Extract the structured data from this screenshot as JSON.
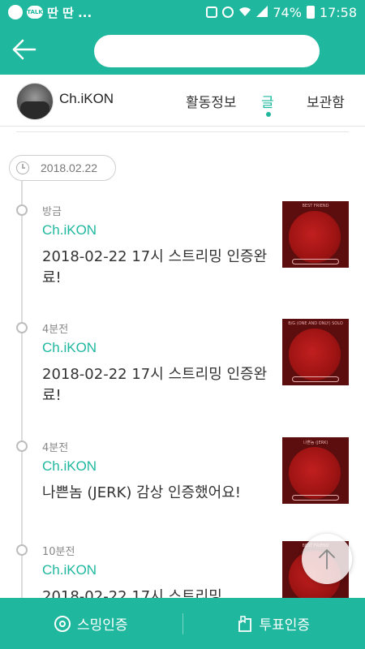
{
  "status_bar": {
    "app_icons_text": "딴 딴 ...",
    "talk_label": "TALK",
    "battery": "74%",
    "time": "17:58"
  },
  "channel": {
    "name": "Ch.iKON",
    "tabs": [
      {
        "label": "활동정보",
        "active": false
      },
      {
        "label": "글",
        "active": true
      },
      {
        "label": "보관함",
        "active": false
      }
    ]
  },
  "timeline": {
    "date": "2018.02.22",
    "posts": [
      {
        "time": "방금",
        "author": "Ch.iKON",
        "text": "2018-02-22 17시 스트리밍 인증완료!",
        "thumb_caption": "BEST FRIEND"
      },
      {
        "time": "4분전",
        "author": "Ch.iKON",
        "text": "2018-02-22 17시 스트리밍 인증완료!",
        "thumb_caption": "B/G (ONE AND ONLY) SOLO"
      },
      {
        "time": "4분전",
        "author": "Ch.iKON",
        "text": "나쁜놈 (JERK) 감상 인증했어요!",
        "thumb_caption": "나쁜놈 (JERK)"
      },
      {
        "time": "10분전",
        "author": "Ch.iKON",
        "text": "2018-02-22 17시 스트리밍",
        "thumb_caption": "BEST FRIEND"
      }
    ]
  },
  "bottom_bar": {
    "stream_label": "스밍인증",
    "vote_label": "투표인증"
  },
  "colors": {
    "accent": "#1fb89f"
  },
  "icons": [
    "back-arrow-icon",
    "clock-icon",
    "stream-disc-icon",
    "vote-clipboard-icon",
    "arrow-up-icon"
  ]
}
